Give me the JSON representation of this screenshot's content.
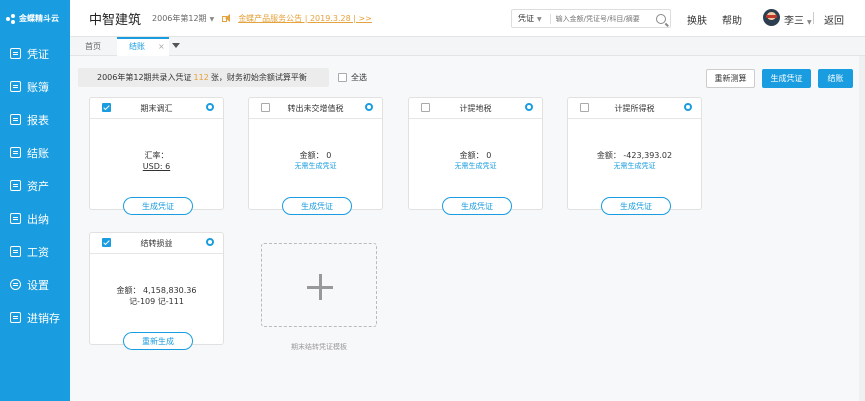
{
  "sidebar": {
    "logo_text": "金蝶精斗云",
    "items": [
      {
        "label": "凭证",
        "icon": "voucher-icon"
      },
      {
        "label": "账簿",
        "icon": "ledger-icon"
      },
      {
        "label": "报表",
        "icon": "report-icon"
      },
      {
        "label": "结账",
        "icon": "closing-icon"
      },
      {
        "label": "资产",
        "icon": "asset-icon"
      },
      {
        "label": "出纳",
        "icon": "cashier-icon"
      },
      {
        "label": "工资",
        "icon": "salary-icon"
      },
      {
        "label": "设置",
        "icon": "gear-icon"
      },
      {
        "label": "进销存",
        "icon": "inventory-icon"
      }
    ]
  },
  "header": {
    "company": "中智建筑",
    "period": "2006年第12期",
    "notice": "金蝶产品服务公告 | 2019.3.28 | >>",
    "search_type": "凭证",
    "search_placeholder": "输入金额/凭证号/科目/摘要",
    "skin": "换肤",
    "help": "帮助",
    "user": "李三",
    "back": "返回"
  },
  "tabs": {
    "home": "首页",
    "active": "结账",
    "close": "×"
  },
  "toolbar": {
    "summary_prefix": "2006年第12期共录入凭证",
    "summary_count": "112",
    "summary_suffix": "张，财务初始余额试算平衡",
    "select_all": "全选",
    "recalc": "重新测算",
    "generate": "生成凭证",
    "close": "结账"
  },
  "cards": [
    {
      "title": "期末调汇",
      "checked": true,
      "line1": "汇率：",
      "line2": "USD: 6",
      "link": "",
      "button": "生成凭证"
    },
    {
      "title": "转出未交增值税",
      "checked": false,
      "line1": "金额： 0",
      "line2": "",
      "link": "无需生成凭证",
      "button": "生成凭证"
    },
    {
      "title": "计提地税",
      "checked": false,
      "line1": "金额： 0",
      "line2": "",
      "link": "无需生成凭证",
      "button": "生成凭证"
    },
    {
      "title": "计提所得税",
      "checked": false,
      "line1": "金额： -423,393.02",
      "line2": "",
      "link": "无需生成凭证",
      "button": "生成凭证"
    },
    {
      "title": "结转损益",
      "checked": true,
      "line1": "金额： 4,158,830.36",
      "line2": "记-109 记-111",
      "link": "",
      "button": "重新生成"
    }
  ],
  "add_template": "期末结转凭证模板",
  "colors": {
    "brand": "#1a9de0",
    "notice": "#e6a23c"
  }
}
